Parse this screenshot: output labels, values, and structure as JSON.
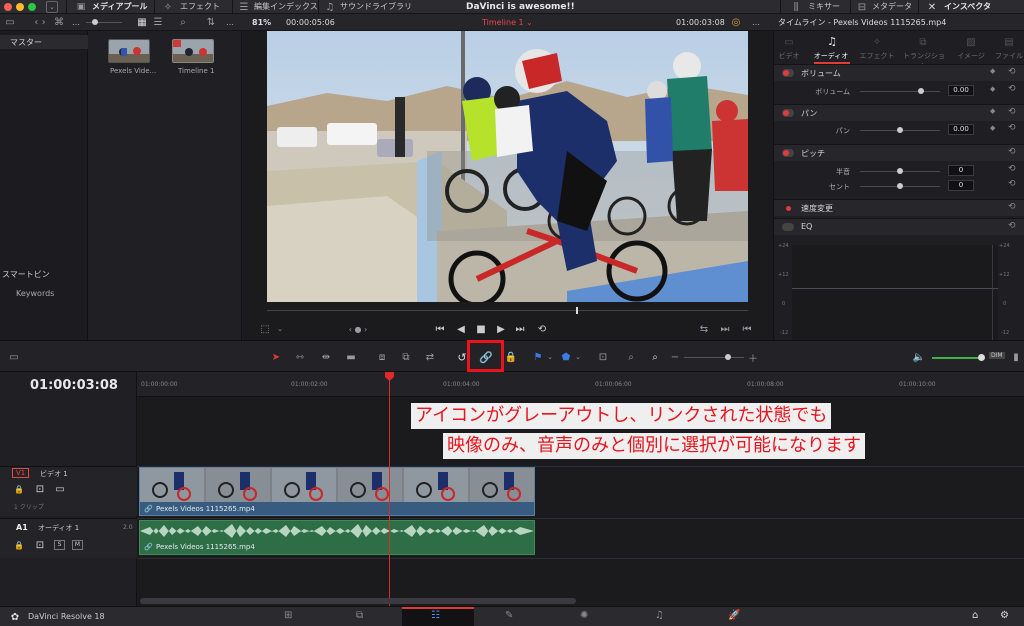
{
  "window": {
    "title": "DaVinci is awesome!!"
  },
  "topbar": {
    "media_pool": "メディアプール",
    "effects": "エフェクト",
    "edit_index": "編集インデックス",
    "sound_library": "サウンドライブラリ",
    "mixer": "ミキサー",
    "metadata": "メタデータ",
    "inspector": "インスペクタ"
  },
  "viewer_bar": {
    "zoom": "81%",
    "source_tc": "00:00:05:06",
    "timeline_name": "Timeline 1",
    "record_tc": "01:00:03:08",
    "inspector_title": "タイムライン - Pexels Videos 1115265.mp4"
  },
  "media_panel": {
    "master": "マスター",
    "smart_bin": "スマートビン",
    "keywords": "Keywords",
    "clips": [
      {
        "label": "Pexels Vide..."
      },
      {
        "label": "Timeline 1"
      }
    ]
  },
  "inspector": {
    "tabs": [
      "ビデオ",
      "オーディオ",
      "エフェクト",
      "トランジション",
      "イメージ",
      "ファイル"
    ],
    "volume": {
      "section": "ボリューム",
      "label": "ボリューム",
      "value": "0.00"
    },
    "pan": {
      "section": "パン",
      "label": "パン",
      "value": "0.00"
    },
    "pitch": {
      "section": "ピッチ",
      "semitone_label": "半音",
      "semitone_value": "0",
      "cent_label": "セント",
      "cent_value": "0"
    },
    "speed_change": "速度変更",
    "eq": {
      "section": "EQ",
      "db_ticks": [
        "+24",
        "+12",
        "0",
        "-12"
      ]
    }
  },
  "timeline": {
    "timecode": "01:00:03:08",
    "ruler": [
      "01:00:00:00",
      "01:00:02:00",
      "01:00:04:00",
      "01:00:06:00",
      "01:00:08:00",
      "01:00:10:00"
    ],
    "video_track": {
      "id": "V1",
      "name": "ビデオ 1",
      "count": "1 クリップ"
    },
    "audio_track": {
      "id": "A1",
      "name": "オーディオ 1",
      "level": "2.0",
      "s": "S",
      "m": "M"
    },
    "clip_video_name": "Pexels Videos 1115265.mp4",
    "clip_audio_name": "Pexels Videos 1115265.mp4",
    "dim": "DIM"
  },
  "annotation": {
    "line1": "アイコンがグレーアウトし、リンクされた状態でも",
    "line2": "映像のみ、音声のみと個別に選択が可能になります"
  },
  "bottom": {
    "app_name": "DaVinci Resolve 18"
  },
  "colors": {
    "accent_red": "#e8141e",
    "video_clip": "#375c80",
    "audio_clip": "#2e6e47",
    "playhead": "#e02a2a"
  }
}
